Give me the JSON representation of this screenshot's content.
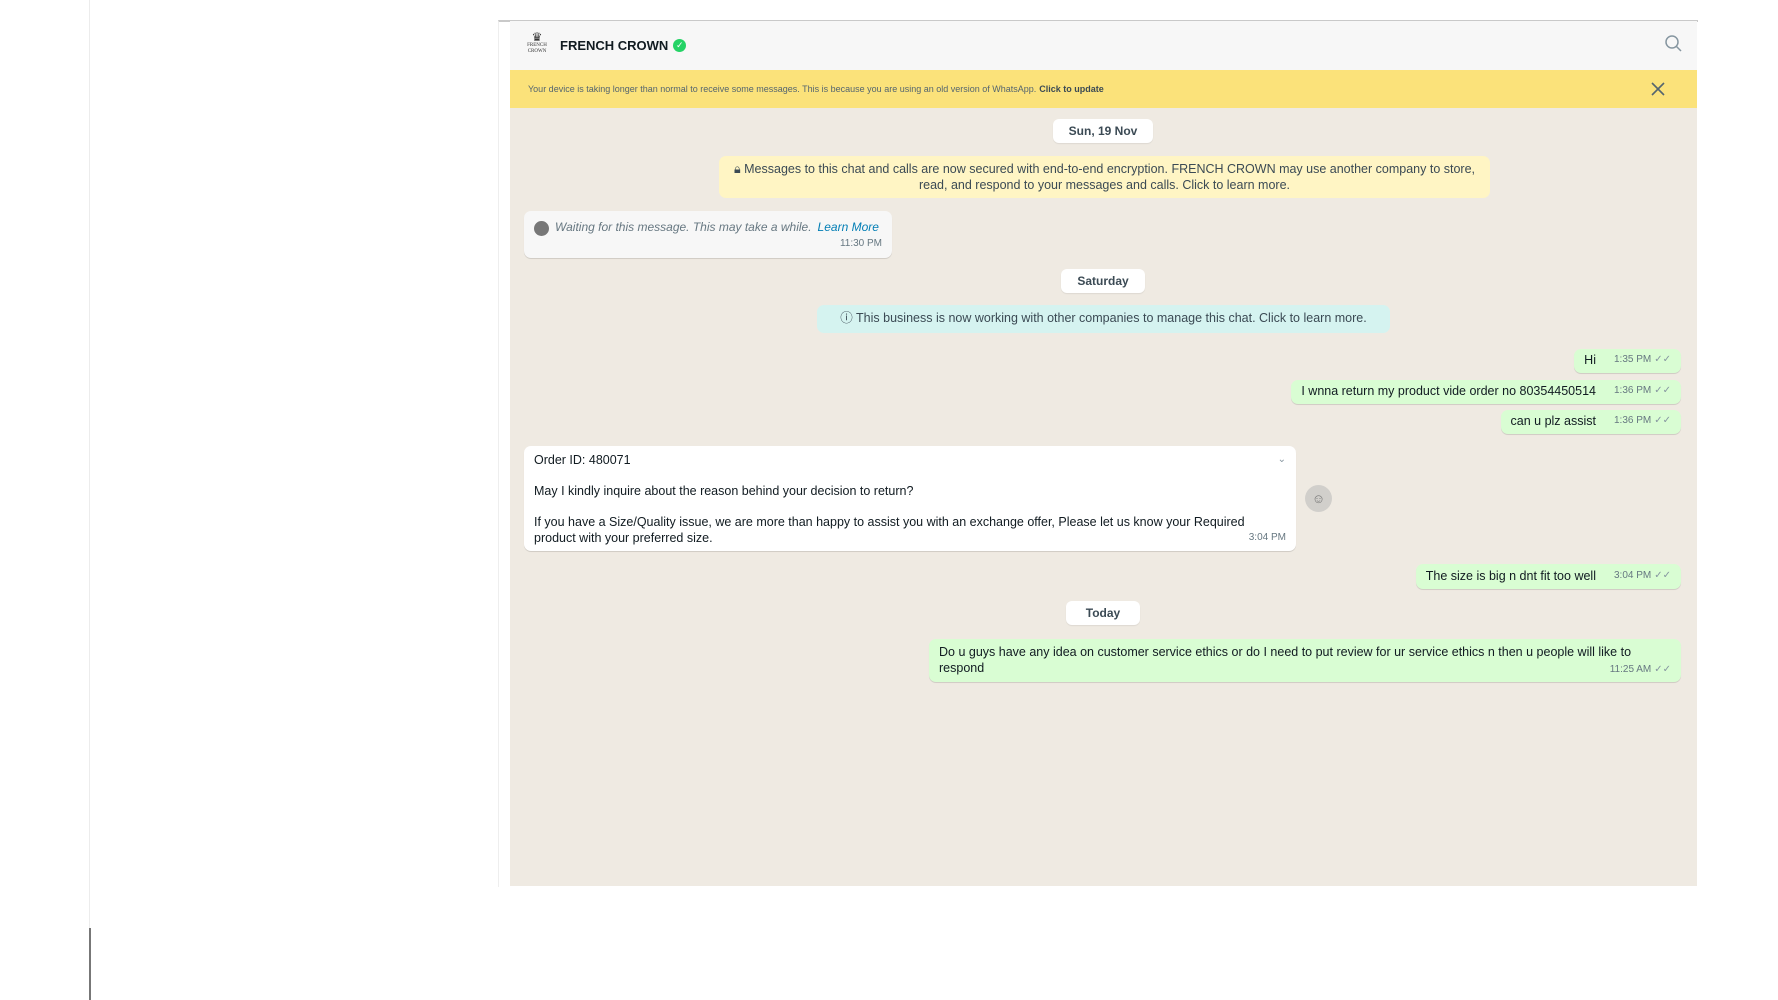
{
  "header": {
    "title": "FRENCH CROWN",
    "logo_text": "FRENCH CROWN",
    "verified_icon": "check-circle-icon",
    "search_icon": "search-icon"
  },
  "banner": {
    "text": "Your device is taking longer than normal to receive some messages. This is because you are using an old version of WhatsApp.",
    "link": "Click to update"
  },
  "dates": [
    "Sun, 19 Nov",
    "Saturday",
    "Today"
  ],
  "encryption_notice": "Messages to this chat and calls are now secured with end-to-end encryption. FRENCH CROWN may use another company to store, read, and respond to your messages and calls. Click to learn more.",
  "waiting": {
    "text": "Waiting for this message. This may take a while.",
    "link": "Learn More",
    "time": "11:30 PM"
  },
  "business_notice": "This business is now working with other companies to manage this chat. Click to learn more.",
  "messages": [
    {
      "text": "Hi",
      "time": "1:35 PM"
    },
    {
      "text": "I wnna return my product vide order no 80354450514",
      "time": "1:36 PM"
    },
    {
      "text": "can u plz assist",
      "time": "1:36 PM"
    },
    {
      "order_id": "Order ID: 480071",
      "line1": "May I kindly inquire about the reason behind your decision to return?",
      "line2": "If you have a Size/Quality issue, we are more than happy to assist you with an exchange offer,  Please let us know your Required product with your preferred size.",
      "time": "3:04 PM"
    },
    {
      "text": "The size is big n dnt fit too well",
      "time": "3:04 PM"
    },
    {
      "text": "Do u guys have any idea on customer service ethics or do I need to put review for ur service ethics n then u people will like to respond",
      "time": "11:25 AM"
    }
  ],
  "tick": "✓✓",
  "colors": {
    "banner": "#fbe27a",
    "outgoing": "#d9fdd3",
    "verified": "#25d366",
    "link": "#027eb5"
  }
}
